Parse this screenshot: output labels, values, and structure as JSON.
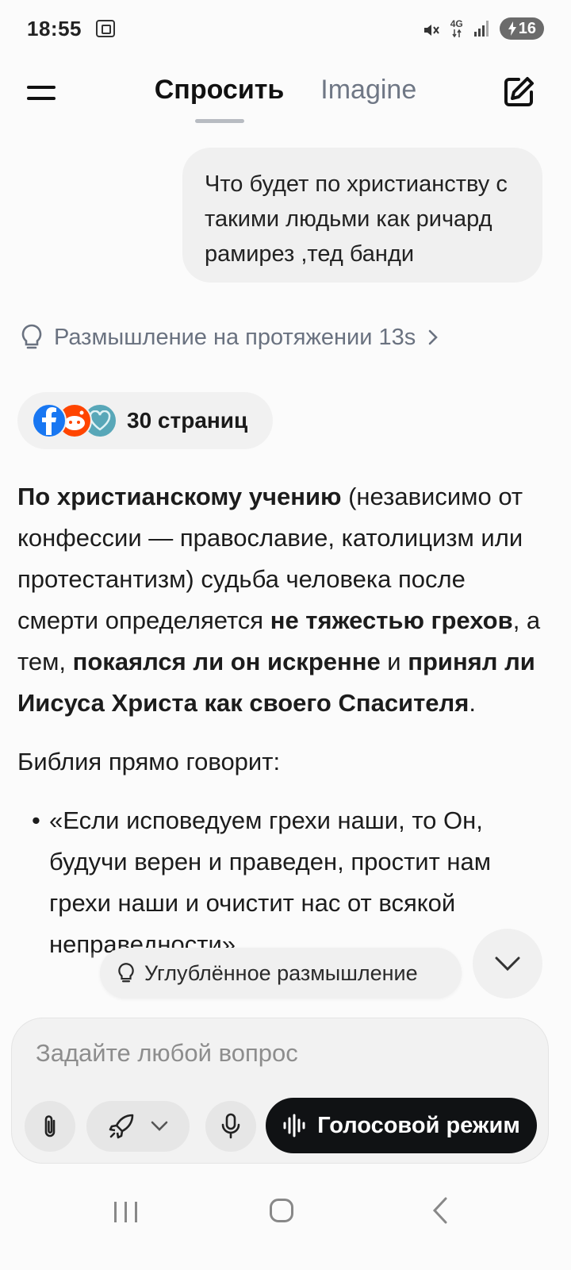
{
  "status_bar": {
    "time": "18:55",
    "network": "4G",
    "battery": "16",
    "icons": [
      "screenshot-icon",
      "mute-icon",
      "signal-icon",
      "battery-charging-icon"
    ]
  },
  "header": {
    "tabs": [
      {
        "label": "Спросить",
        "active": true
      },
      {
        "label": "Imagine",
        "active": false
      }
    ],
    "icons": [
      "menu-icon",
      "edit-icon"
    ]
  },
  "conversation": {
    "user_message": "Что будет по христианству с такими людьми как ричард рамирез ,тед банди",
    "thinking_label": "Размышление на протяжении 13s",
    "sources_label": "30 страниц",
    "source_icons": [
      "facebook-icon",
      "reddit-icon",
      "heart-icon"
    ],
    "answer": {
      "p1_b1": "По христианскому учению",
      "p1_t1": " (независимо от конфессии — православие, католицизм или протестантизм) судьба человека после смерти определяется ",
      "p1_b2": "не тяжестью грехов",
      "p1_t2": ", а тем, ",
      "p1_b3": "покаялся ли он искренне",
      "p1_t3": " и ",
      "p1_b4": "принял ли Иисуса Христа как своего Спасителя",
      "p1_t4": ".",
      "p2": "Библия прямо говорит:",
      "bullet1": "«Если исповедуем грехи наши, то Он, будучи верен и праведен, простит нам грехи наши и очистит нас от всякой неправедности»"
    }
  },
  "floating": {
    "deep_think_label": "Углублённое размышление",
    "icons": [
      "lightbulb-icon",
      "chevron-down-icon"
    ]
  },
  "composer": {
    "placeholder": "Задайте любой вопрос",
    "voice_label": "Голосовой режим",
    "icons": [
      "paperclip-icon",
      "rocket-icon",
      "chevron-down-icon",
      "microphone-icon",
      "waveform-icon"
    ]
  },
  "colors": {
    "background": "#fbfbfb",
    "bubble": "#f0f0f0",
    "muted_text": "#6f7785",
    "voice_button": "#101214"
  }
}
